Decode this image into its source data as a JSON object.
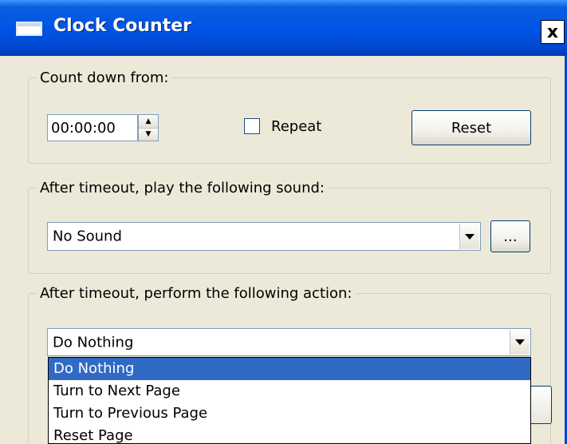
{
  "window": {
    "title": "Clock Counter",
    "close_label": "x"
  },
  "countdown": {
    "legend": "Count down from:",
    "time_value": "00:00:00",
    "repeat_label": "Repeat",
    "repeat_checked": false,
    "reset_label": "Reset"
  },
  "sound": {
    "legend": "After timeout, play the following sound:",
    "selected": "No Sound",
    "browse_label": "..."
  },
  "action": {
    "legend": "After timeout, perform the following action:",
    "selected": "Do Nothing",
    "options": [
      "Do Nothing",
      "Turn to Next Page",
      "Turn to Previous Page",
      "Reset Page"
    ],
    "highlighted_index": 0
  },
  "colors": {
    "title_bar": "#0055e5",
    "dialog_bg": "#ece9d8",
    "selection": "#316ac5"
  }
}
